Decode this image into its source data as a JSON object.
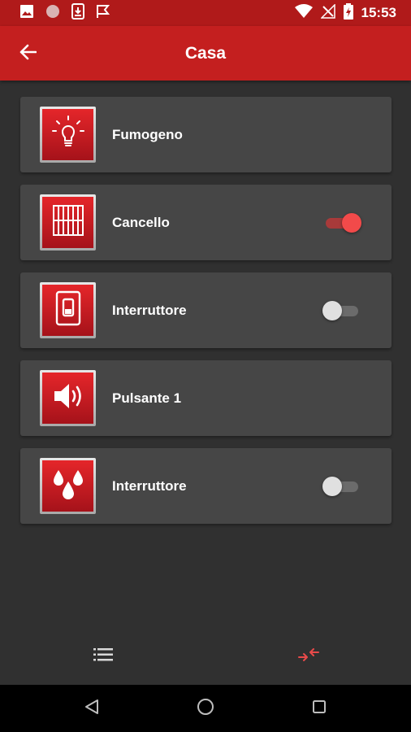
{
  "status_bar": {
    "time": "15:53",
    "icons_left": [
      "image-icon",
      "circle-icon",
      "download-icon",
      "flag-icon"
    ],
    "icons_right": [
      "wifi-icon",
      "no-signal-icon",
      "battery-charging-icon"
    ]
  },
  "app_bar": {
    "title": "Casa",
    "back_icon": "arrow-left-icon"
  },
  "devices": [
    {
      "label": "Fumogeno",
      "icon": "lightbulb-icon",
      "has_toggle": false
    },
    {
      "label": "Cancello",
      "icon": "gate-icon",
      "has_toggle": true,
      "toggle_on": true
    },
    {
      "label": "Interruttore",
      "icon": "wall-switch-icon",
      "has_toggle": true,
      "toggle_on": false
    },
    {
      "label": "Pulsante 1",
      "icon": "speaker-icon",
      "has_toggle": false
    },
    {
      "label": "Interruttore",
      "icon": "water-drops-icon",
      "has_toggle": true,
      "toggle_on": false
    }
  ],
  "bottom_bar": {
    "left_icon": "list-icon",
    "right_icon": "compress-arrows-icon"
  },
  "nav_bar": {
    "icons": [
      "back-triangle-icon",
      "home-circle-icon",
      "recents-square-icon"
    ]
  },
  "colors": {
    "app_bar": "#c41f1f",
    "status_bar": "#b01a1a",
    "background": "#303030",
    "card": "#464646",
    "accent": "#f24a4a"
  }
}
